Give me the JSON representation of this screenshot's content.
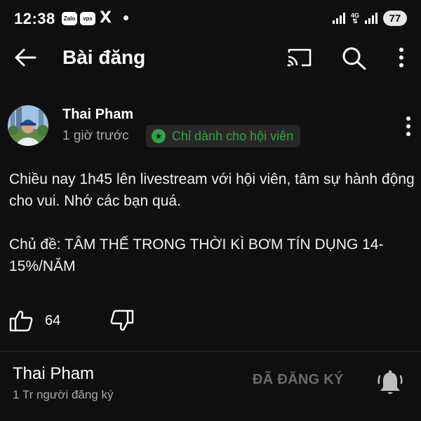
{
  "status_bar": {
    "time": "12:38",
    "apps": [
      "Zalo",
      "vps"
    ],
    "x_label": "X",
    "network": "4G",
    "battery": "77"
  },
  "header": {
    "title": "Bài đăng"
  },
  "post": {
    "author": "Thai Pham",
    "time": "1 giờ trước",
    "badge": "Chỉ dành cho hội viên",
    "paragraphs": [
      "Chiều nay 1h45 lên livestream với hội viên, tâm sự hành động cho vui. Nhớ các bạn quá.",
      "Chủ đề: TÂM THẾ TRONG THỜI KÌ BƠM TÍN DỤNG 14-15%/NĂM"
    ],
    "likes": "64"
  },
  "channel": {
    "name": "Thai Pham",
    "subscribers": "1 Tr người đăng ký",
    "subscribe_label": "ĐÃ ĐĂNG KÝ"
  },
  "colors": {
    "background": "#0f0f0f",
    "member_green": "#2ba640",
    "secondary_text": "#aaaaaa"
  },
  "icons": [
    "back-arrow-icon",
    "cast-icon",
    "search-icon",
    "more-vert-icon",
    "star-icon",
    "thumb-up-icon",
    "thumb-down-icon",
    "bell-icon"
  ]
}
